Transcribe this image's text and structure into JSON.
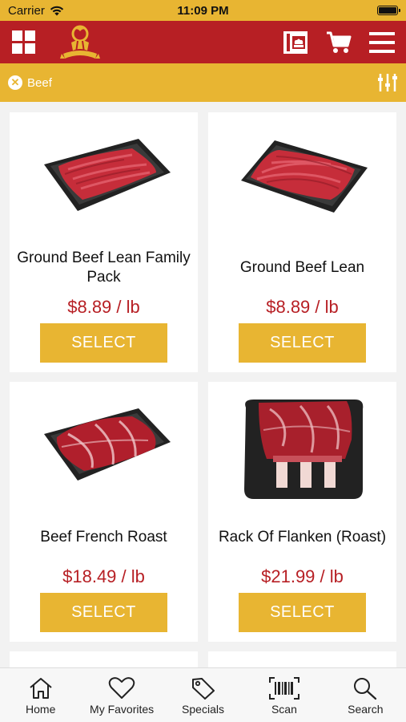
{
  "status": {
    "carrier": "Carrier",
    "time": "11:09 PM"
  },
  "header": {
    "icons": [
      "grid-icon",
      "brand-logo",
      "recipe-card-icon",
      "cart-icon",
      "hamburger-menu-icon"
    ],
    "colors": {
      "header_bg": "#b71f24",
      "accent": "#e8b532"
    }
  },
  "filter": {
    "active_chip": "Beef",
    "icon": "filter-sliders-icon"
  },
  "products": [
    {
      "name": "Ground Beef Lean Family Pack",
      "price": "$8.89 / lb",
      "button": "SELECT"
    },
    {
      "name": "Ground Beef Lean",
      "price": "$8.89 / lb",
      "button": "SELECT"
    },
    {
      "name": "Beef French Roast",
      "price": "$18.49 / lb",
      "button": "SELECT"
    },
    {
      "name": "Rack Of Flanken (Roast)",
      "price": "$21.99 / lb",
      "button": "SELECT"
    }
  ],
  "tabs": [
    {
      "label": "Home",
      "icon": "home-icon"
    },
    {
      "label": "My Favorites",
      "icon": "heart-icon"
    },
    {
      "label": "Specials",
      "icon": "tag-icon"
    },
    {
      "label": "Scan",
      "icon": "barcode-icon"
    },
    {
      "label": "Search",
      "icon": "search-icon"
    }
  ]
}
